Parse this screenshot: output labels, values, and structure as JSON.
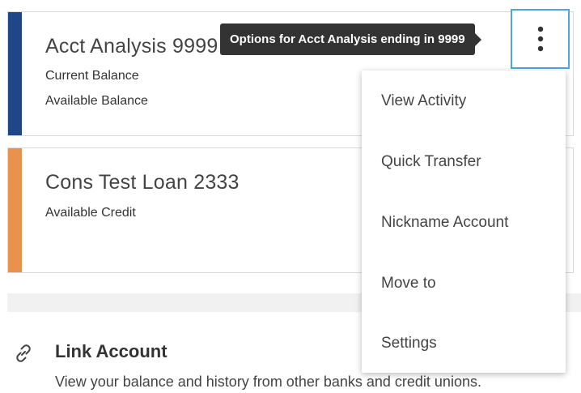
{
  "colors": {
    "checking_stripe": "#1f4788",
    "loan_stripe": "#e8924d",
    "tooltip_bg": "#333333",
    "focus_border": "#4aa8de",
    "band": "#f1f1f1"
  },
  "accounts": [
    {
      "name": "Acct Analysis 9999",
      "lines": [
        "Current Balance",
        "Available Balance"
      ]
    },
    {
      "name": "Cons Test Loan 2333",
      "lines": [
        "Available Credit"
      ]
    }
  ],
  "options_button": {
    "icon": "kebab-vertical-icon",
    "tooltip": "Options for Acct Analysis ending in 9999"
  },
  "menu": {
    "items": [
      {
        "label": "View Activity"
      },
      {
        "label": "Quick Transfer"
      },
      {
        "label": "Nickname Account"
      },
      {
        "label": "Move to"
      },
      {
        "label": "Settings"
      }
    ]
  },
  "link_account": {
    "icon": "link-icon",
    "title": "Link Account",
    "description": "View your balance and history from other banks and credit unions."
  }
}
